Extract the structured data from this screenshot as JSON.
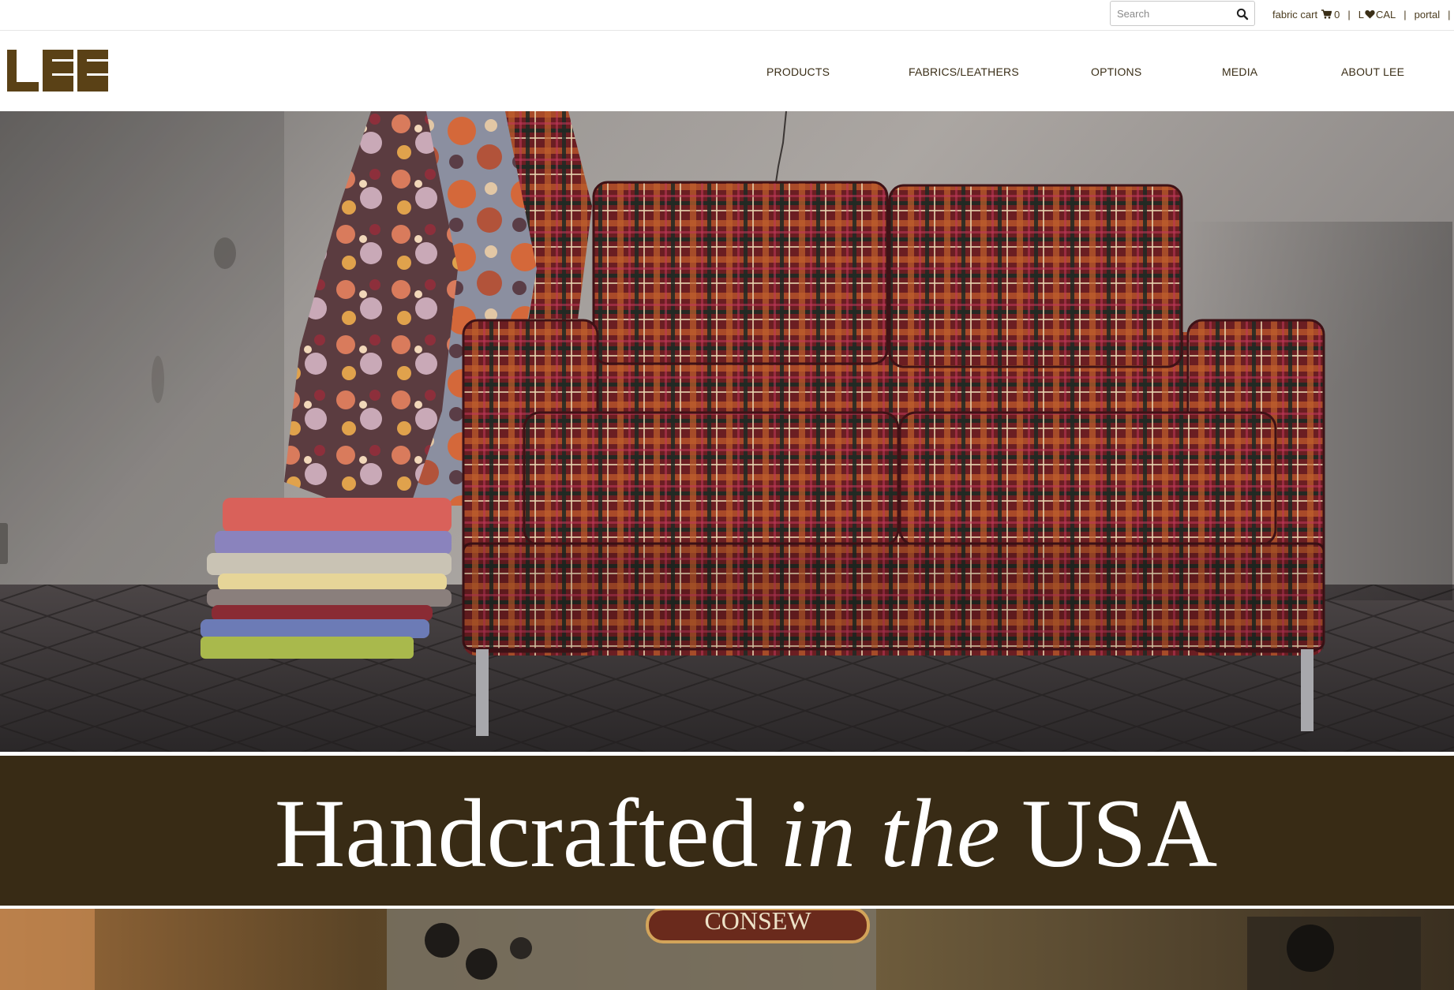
{
  "utility": {
    "search_placeholder": "Search",
    "fabric_cart_label": "fabric cart",
    "cart_count": "0",
    "local_prefix": "L",
    "local_suffix": "CAL",
    "portal_label": "portal",
    "separator": "|"
  },
  "header": {
    "logo_text": "LEE",
    "nav": [
      {
        "label": "PRODUCTS"
      },
      {
        "label": "FABRICS/LEATHERS"
      },
      {
        "label": "OPTIONS"
      },
      {
        "label": "MEDIA"
      },
      {
        "label": "ABOUT LEE"
      }
    ]
  },
  "hero": {
    "image_subject": "plaid loveseat with fabric bolts and folded fabric stack"
  },
  "banner": {
    "text_start": "Handcrafted",
    "text_italic": "in the",
    "text_end": "USA"
  },
  "bottom_image": {
    "badge_text": "CONSEW"
  },
  "colors": {
    "brand_brown": "#5a4116",
    "banner_bg": "#382b15",
    "nav_text": "#3a2e17"
  },
  "icons": [
    "search-icon",
    "cart-icon",
    "heart-icon",
    "lee-logo"
  ]
}
